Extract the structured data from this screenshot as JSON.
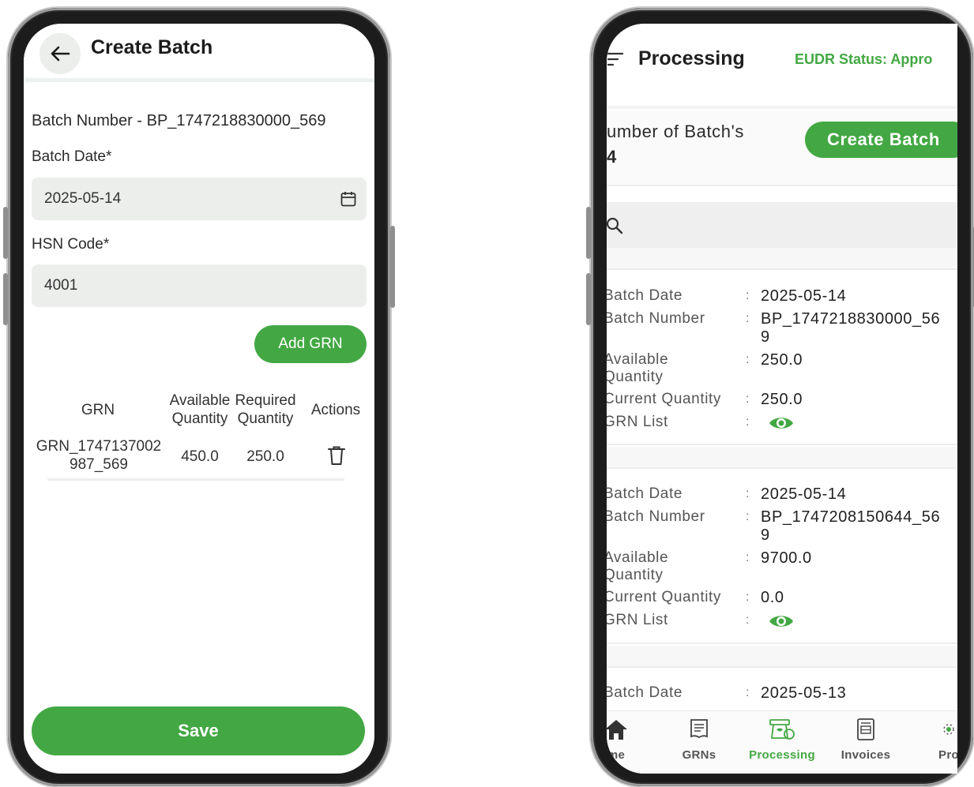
{
  "left_screen": {
    "title": "Create Batch",
    "batch_number_text": "Batch Number - BP_1747218830000_569",
    "batch_date_label": "Batch Date*",
    "batch_date_value": "2025-05-14",
    "hsn_label": "HSN Code*",
    "hsn_value": "4001",
    "add_grn_label": "Add GRN",
    "table": {
      "headers": [
        "GRN",
        "Available Quantity",
        "Required Quantity",
        "Actions"
      ],
      "header_lines": {
        "grn": "GRN",
        "available_1": "Available",
        "available_2": "Quantity",
        "required_1": "Required",
        "required_2": "Quantity",
        "actions": "Actions"
      },
      "rows": [
        {
          "grn_line1": "GRN_1747137002",
          "grn_line2": "987_569",
          "available": "450.0",
          "required": "250.0"
        }
      ]
    },
    "save_label": "Save"
  },
  "right_screen": {
    "title": "Processing",
    "eudr_status": "EUDR Status: Appro",
    "count_label": "umber of Batch's",
    "count_value": "4",
    "create_batch_label": "Create Batch",
    "batches": [
      {
        "date_key": "Batch Date",
        "date": "2025-05-14",
        "number_key": "Batch Number",
        "number_line1": "BP_1747218830000_56",
        "number_line2": "9",
        "available_key_1": "Available",
        "available_key_2": "Quantity",
        "available": "250.0",
        "current_key": "Current Quantity",
        "current": "250.0",
        "grn_list_key": "GRN List"
      },
      {
        "date_key": "Batch Date",
        "date": "2025-05-14",
        "number_key": "Batch Number",
        "number_line1": "BP_1747208150644_56",
        "number_line2": "9",
        "available_key_1": "Available",
        "available_key_2": "Quantity",
        "available": "9700.0",
        "current_key": "Current Quantity",
        "current": "0.0",
        "grn_list_key": "GRN List"
      },
      {
        "date_key": "Batch Date",
        "date": "2025-05-13"
      }
    ],
    "bottom_nav": [
      {
        "label": "me",
        "icon": "home-icon"
      },
      {
        "label": "GRNs",
        "icon": "grns-icon"
      },
      {
        "label": "Processing",
        "icon": "processing-icon",
        "active": true
      },
      {
        "label": "Invoices",
        "icon": "invoices-icon"
      },
      {
        "label": "Pro",
        "icon": "profile-icon"
      }
    ]
  },
  "colors": {
    "accent_green": "#43a843",
    "field_bg": "#eceeec",
    "text_dark": "#1f1f1f"
  }
}
